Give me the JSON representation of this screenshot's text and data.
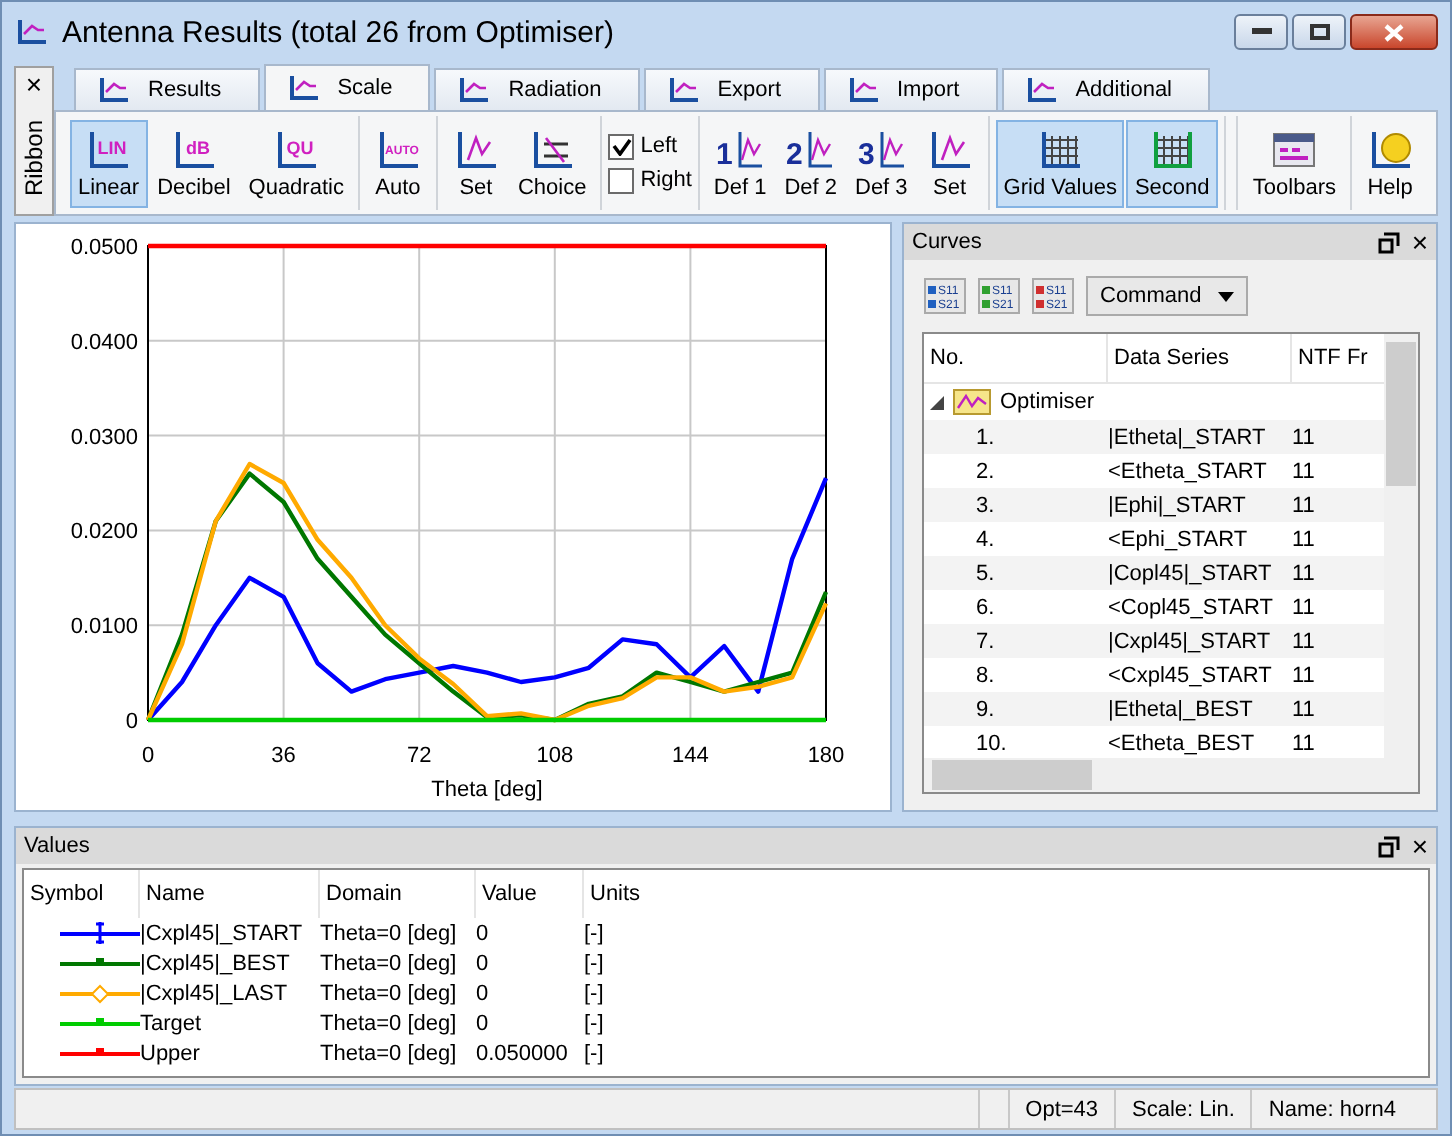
{
  "window": {
    "title": "Antenna Results (total 26 from Optimiser)"
  },
  "ribbon": {
    "label": "Ribbon",
    "close": "×",
    "tabs": [
      {
        "label": "Results",
        "selected": false
      },
      {
        "label": "Scale",
        "selected": true
      },
      {
        "label": "Radiation",
        "selected": false
      },
      {
        "label": "Export",
        "selected": false
      },
      {
        "label": "Import",
        "selected": false
      },
      {
        "label": "Additional",
        "selected": false
      }
    ],
    "groups": [
      {
        "kind": "buttons",
        "items": [
          {
            "label": "Linear",
            "kind": "scale",
            "icon_text": "LIN",
            "selected": true
          },
          {
            "label": "Decibel",
            "kind": "scale",
            "icon_text": "dB",
            "selected": false
          },
          {
            "label": "Quadratic",
            "kind": "scale",
            "icon_text": "QU",
            "selected": false
          }
        ]
      },
      {
        "kind": "buttons",
        "items": [
          {
            "label": "Auto",
            "kind": "scale",
            "icon_text": "AUTO",
            "selected": false
          }
        ]
      },
      {
        "kind": "buttons",
        "items": [
          {
            "label": "Set",
            "kind": "chart",
            "selected": false
          },
          {
            "label": "Choice",
            "kind": "choice",
            "selected": false
          }
        ]
      },
      {
        "kind": "checks",
        "items": [
          {
            "label": "Left",
            "checked": true
          },
          {
            "label": "Right",
            "checked": false
          }
        ]
      },
      {
        "kind": "buttons",
        "items": [
          {
            "label": "Def 1",
            "kind": "def",
            "icon_text": "1",
            "selected": false
          },
          {
            "label": "Def 2",
            "kind": "def",
            "icon_text": "2",
            "selected": false
          },
          {
            "label": "Def 3",
            "kind": "def",
            "icon_text": "3",
            "selected": false
          },
          {
            "label": "Set",
            "kind": "chart",
            "selected": false
          }
        ]
      },
      {
        "kind": "buttons",
        "items": [
          {
            "label": "Grid Values",
            "kind": "grid",
            "selected": true
          },
          {
            "label": "Second",
            "kind": "second",
            "selected": true
          }
        ]
      }
    ],
    "right_groups": [
      {
        "kind": "buttons",
        "items": [
          {
            "label": "Toolbars",
            "kind": "toolbars",
            "selected": false
          }
        ]
      },
      {
        "kind": "buttons",
        "items": [
          {
            "label": "Help",
            "kind": "help",
            "selected": false
          }
        ]
      }
    ]
  },
  "chart": {
    "chart_data": {
      "type": "line",
      "grid": true,
      "xlabel": "Theta [deg]",
      "xlim": [
        0,
        180
      ],
      "ylim": [
        0,
        0.05
      ],
      "xticks": [
        0,
        36,
        72,
        108,
        144,
        180
      ],
      "yticks": [
        {
          "value": 0,
          "label": "0"
        },
        {
          "value": 0.01,
          "label": "0.0100"
        },
        {
          "value": 0.02,
          "label": "0.0200"
        },
        {
          "value": 0.03,
          "label": "0.0300"
        },
        {
          "value": 0.04,
          "label": "0.0400"
        },
        {
          "value": 0.05,
          "label": "0.0500"
        }
      ],
      "x": [
        0,
        9,
        18,
        27,
        36,
        45,
        54,
        63,
        72,
        81,
        90,
        99,
        108,
        117,
        126,
        135,
        144,
        153,
        162,
        171,
        180
      ],
      "series": [
        {
          "color": "#0000ff",
          "values": [
            0,
            0.004,
            0.01,
            0.015,
            0.013,
            0.006,
            0.003,
            0.0043,
            0.005,
            0.0057,
            0.005,
            0.004,
            0.0045,
            0.0055,
            0.0085,
            0.008,
            0.0045,
            0.0078,
            0.003,
            0.017,
            0.0255
          ]
        },
        {
          "color": "#007700",
          "values": [
            0,
            0.009,
            0.021,
            0.026,
            0.023,
            0.017,
            0.013,
            0.009,
            0.006,
            0.003,
            0.0003,
            0.0005,
            0,
            0.0017,
            0.0025,
            0.005,
            0.004,
            0.003,
            0.004,
            0.005,
            0.0135
          ]
        },
        {
          "color": "#ffaa00",
          "values": [
            0,
            0.008,
            0.021,
            0.027,
            0.025,
            0.019,
            0.015,
            0.01,
            0.0065,
            0.0038,
            0.0004,
            0.0007,
            0,
            0.0015,
            0.0023,
            0.0045,
            0.0045,
            0.003,
            0.0035,
            0.0045,
            0.0123
          ]
        },
        {
          "color": "#00cc00",
          "values": [
            0,
            0,
            0,
            0,
            0,
            0,
            0,
            0,
            0,
            0,
            0,
            0,
            0,
            0,
            0,
            0,
            0,
            0,
            0,
            0,
            0
          ]
        },
        {
          "color": "#ff0000",
          "values": [
            0.05,
            0.05,
            0.05,
            0.05,
            0.05,
            0.05,
            0.05,
            0.05,
            0.05,
            0.05,
            0.05,
            0.05,
            0.05,
            0.05,
            0.05,
            0.05,
            0.05,
            0.05,
            0.05,
            0.05,
            0.05
          ]
        }
      ]
    }
  },
  "curves": {
    "title": "Curves",
    "close": "×",
    "tools": [
      {
        "top": "S11",
        "bottom": "S21"
      },
      {
        "top": "S11",
        "bottom": "S21"
      },
      {
        "top": "S11",
        "bottom": "S21"
      }
    ],
    "command": "Command",
    "columns": [
      "No.",
      "Data Series",
      "NTF Fr"
    ],
    "group": {
      "label": "Optimiser",
      "expanded": true,
      "rows": [
        {
          "no": "1.",
          "series": "|Etheta|_START",
          "ntf": "11"
        },
        {
          "no": "2.",
          "series": "<Etheta_START",
          "ntf": "11"
        },
        {
          "no": "3.",
          "series": "|Ephi|_START",
          "ntf": "11"
        },
        {
          "no": "4.",
          "series": "<Ephi_START",
          "ntf": "11"
        },
        {
          "no": "5.",
          "series": "|Copl45|_START",
          "ntf": "11"
        },
        {
          "no": "6.",
          "series": "<Copl45_START",
          "ntf": "11"
        },
        {
          "no": "7.",
          "series": "|Cxpl45|_START",
          "ntf": "11"
        },
        {
          "no": "8.",
          "series": "<Cxpl45_START",
          "ntf": "11"
        },
        {
          "no": "9.",
          "series": "|Etheta|_BEST",
          "ntf": "11"
        },
        {
          "no": "10.",
          "series": "<Etheta_BEST",
          "ntf": "11"
        }
      ]
    }
  },
  "values": {
    "title": "Values",
    "close": "×",
    "columns": [
      "Symbol",
      "Name",
      "Domain",
      "Value",
      "Units"
    ],
    "rows": [
      {
        "color": "#0000ff",
        "kind": "ibeam",
        "name": "|Cxpl45|_START",
        "domain": "Theta=0 [deg]",
        "value": "0",
        "units": "[-]"
      },
      {
        "color": "#007700",
        "kind": "tee",
        "name": "|Cxpl45|_BEST",
        "domain": "Theta=0 [deg]",
        "value": "0",
        "units": "[-]"
      },
      {
        "color": "#ffaa00",
        "kind": "diamond",
        "name": "|Cxpl45|_LAST",
        "domain": "Theta=0 [deg]",
        "value": "0",
        "units": "[-]"
      },
      {
        "color": "#00cc00",
        "kind": "tee",
        "name": "Target",
        "domain": "Theta=0 [deg]",
        "value": "0",
        "units": "[-]"
      },
      {
        "color": "#ff0000",
        "kind": "tee",
        "name": "Upper",
        "domain": "Theta=0 [deg]",
        "value": "0.050000",
        "units": "[-]"
      }
    ]
  },
  "status_bar": {
    "cells": [
      "Opt=43",
      "Scale: Lin.",
      "Name: horn4"
    ]
  }
}
